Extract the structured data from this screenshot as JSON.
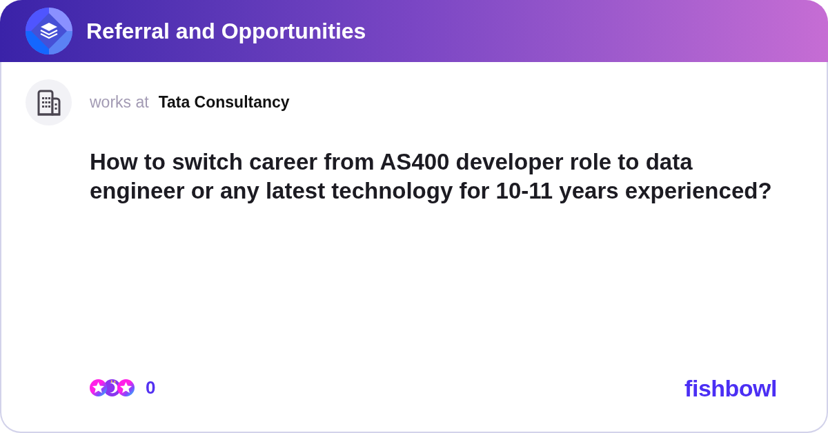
{
  "header": {
    "title": "Referral and Opportunities"
  },
  "post": {
    "author_prefix": "works at",
    "company": "Tata Consultancy",
    "question": "How to switch career from AS400 developer role to data engineer or any latest technology for 10-11 years experienced?"
  },
  "footer": {
    "reaction_count": "0",
    "brand": "fishbowl"
  }
}
